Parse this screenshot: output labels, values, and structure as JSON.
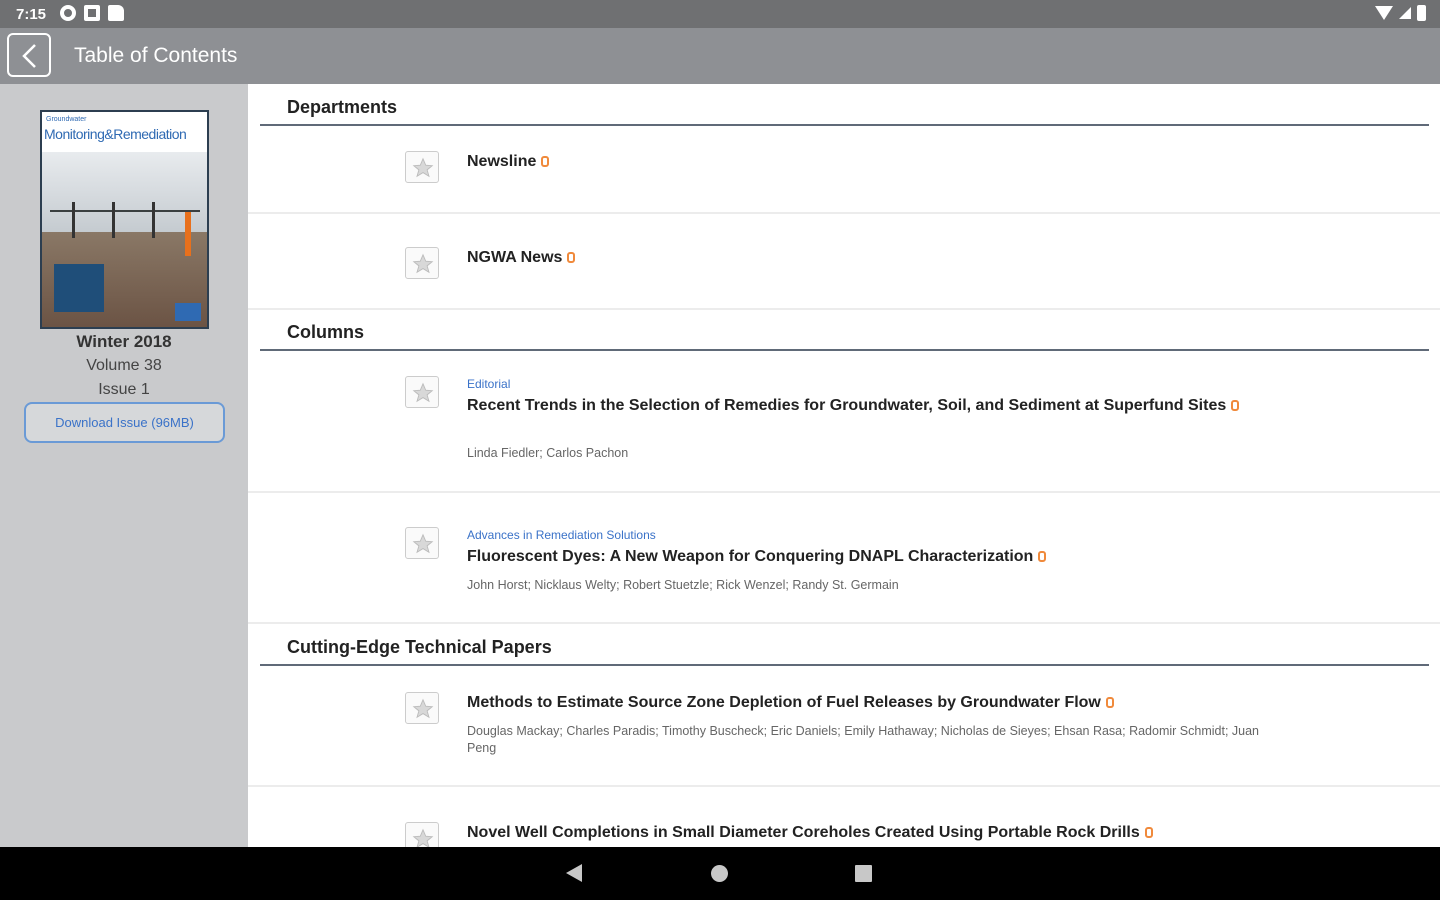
{
  "status_bar": {
    "time": "7:15",
    "left_icons": [
      "gear-icon",
      "square-icon",
      "sd-card-icon"
    ],
    "right_icons": [
      "wifi-icon",
      "signal-icon",
      "battery-icon"
    ]
  },
  "app_bar": {
    "title": "Table of Contents",
    "back_icon": "chevron-left-icon",
    "background": "#8e9094"
  },
  "sidebar": {
    "cover": {
      "masthead_small": "Groundwater",
      "masthead": "Monitoring&Remediation"
    },
    "season": "Winter 2018",
    "volume": "Volume 38",
    "issue": "Issue 1",
    "download_label": "Download Issue (96MB)"
  },
  "sections": [
    {
      "heading": "Departments",
      "articles": [
        {
          "category": "",
          "title": "Newsline",
          "authors": ""
        },
        {
          "category": "",
          "title": "NGWA News",
          "authors": ""
        }
      ]
    },
    {
      "heading": "Columns",
      "articles": [
        {
          "category": "Editorial",
          "title": "Recent Trends in the Selection of Remedies for Groundwater, Soil, and Sediment at Superfund Sites",
          "authors": "Linda Fiedler; Carlos Pachon"
        },
        {
          "category": "Advances in Remediation Solutions",
          "title": "Fluorescent Dyes: A New Weapon for Conquering DNAPL Characterization",
          "authors": "John Horst; Nicklaus Welty; Robert Stuetzle; Rick Wenzel; Randy St. Germain"
        }
      ]
    },
    {
      "heading": "Cutting-Edge Technical Papers",
      "articles": [
        {
          "category": "",
          "title": "Methods to Estimate Source Zone Depletion of Fuel Releases by Groundwater Flow",
          "authors": "Douglas Mackay; Charles Paradis; Timothy Buscheck; Eric Daniels; Emily Hathaway; Nicholas de Sieyes; Ehsan Rasa; Radomir Schmidt; Juan Peng"
        },
        {
          "category": "",
          "title": "Novel Well Completions in Small Diameter Coreholes Created Using Portable Rock Drills",
          "authors": ""
        }
      ]
    }
  ],
  "icons": {
    "favorite": "star-icon",
    "access": "lock-icon"
  },
  "colors": {
    "accent_blue": "#3a72c8",
    "lock_orange": "#f08a3c",
    "sidebar_bg": "#c9cacc"
  }
}
